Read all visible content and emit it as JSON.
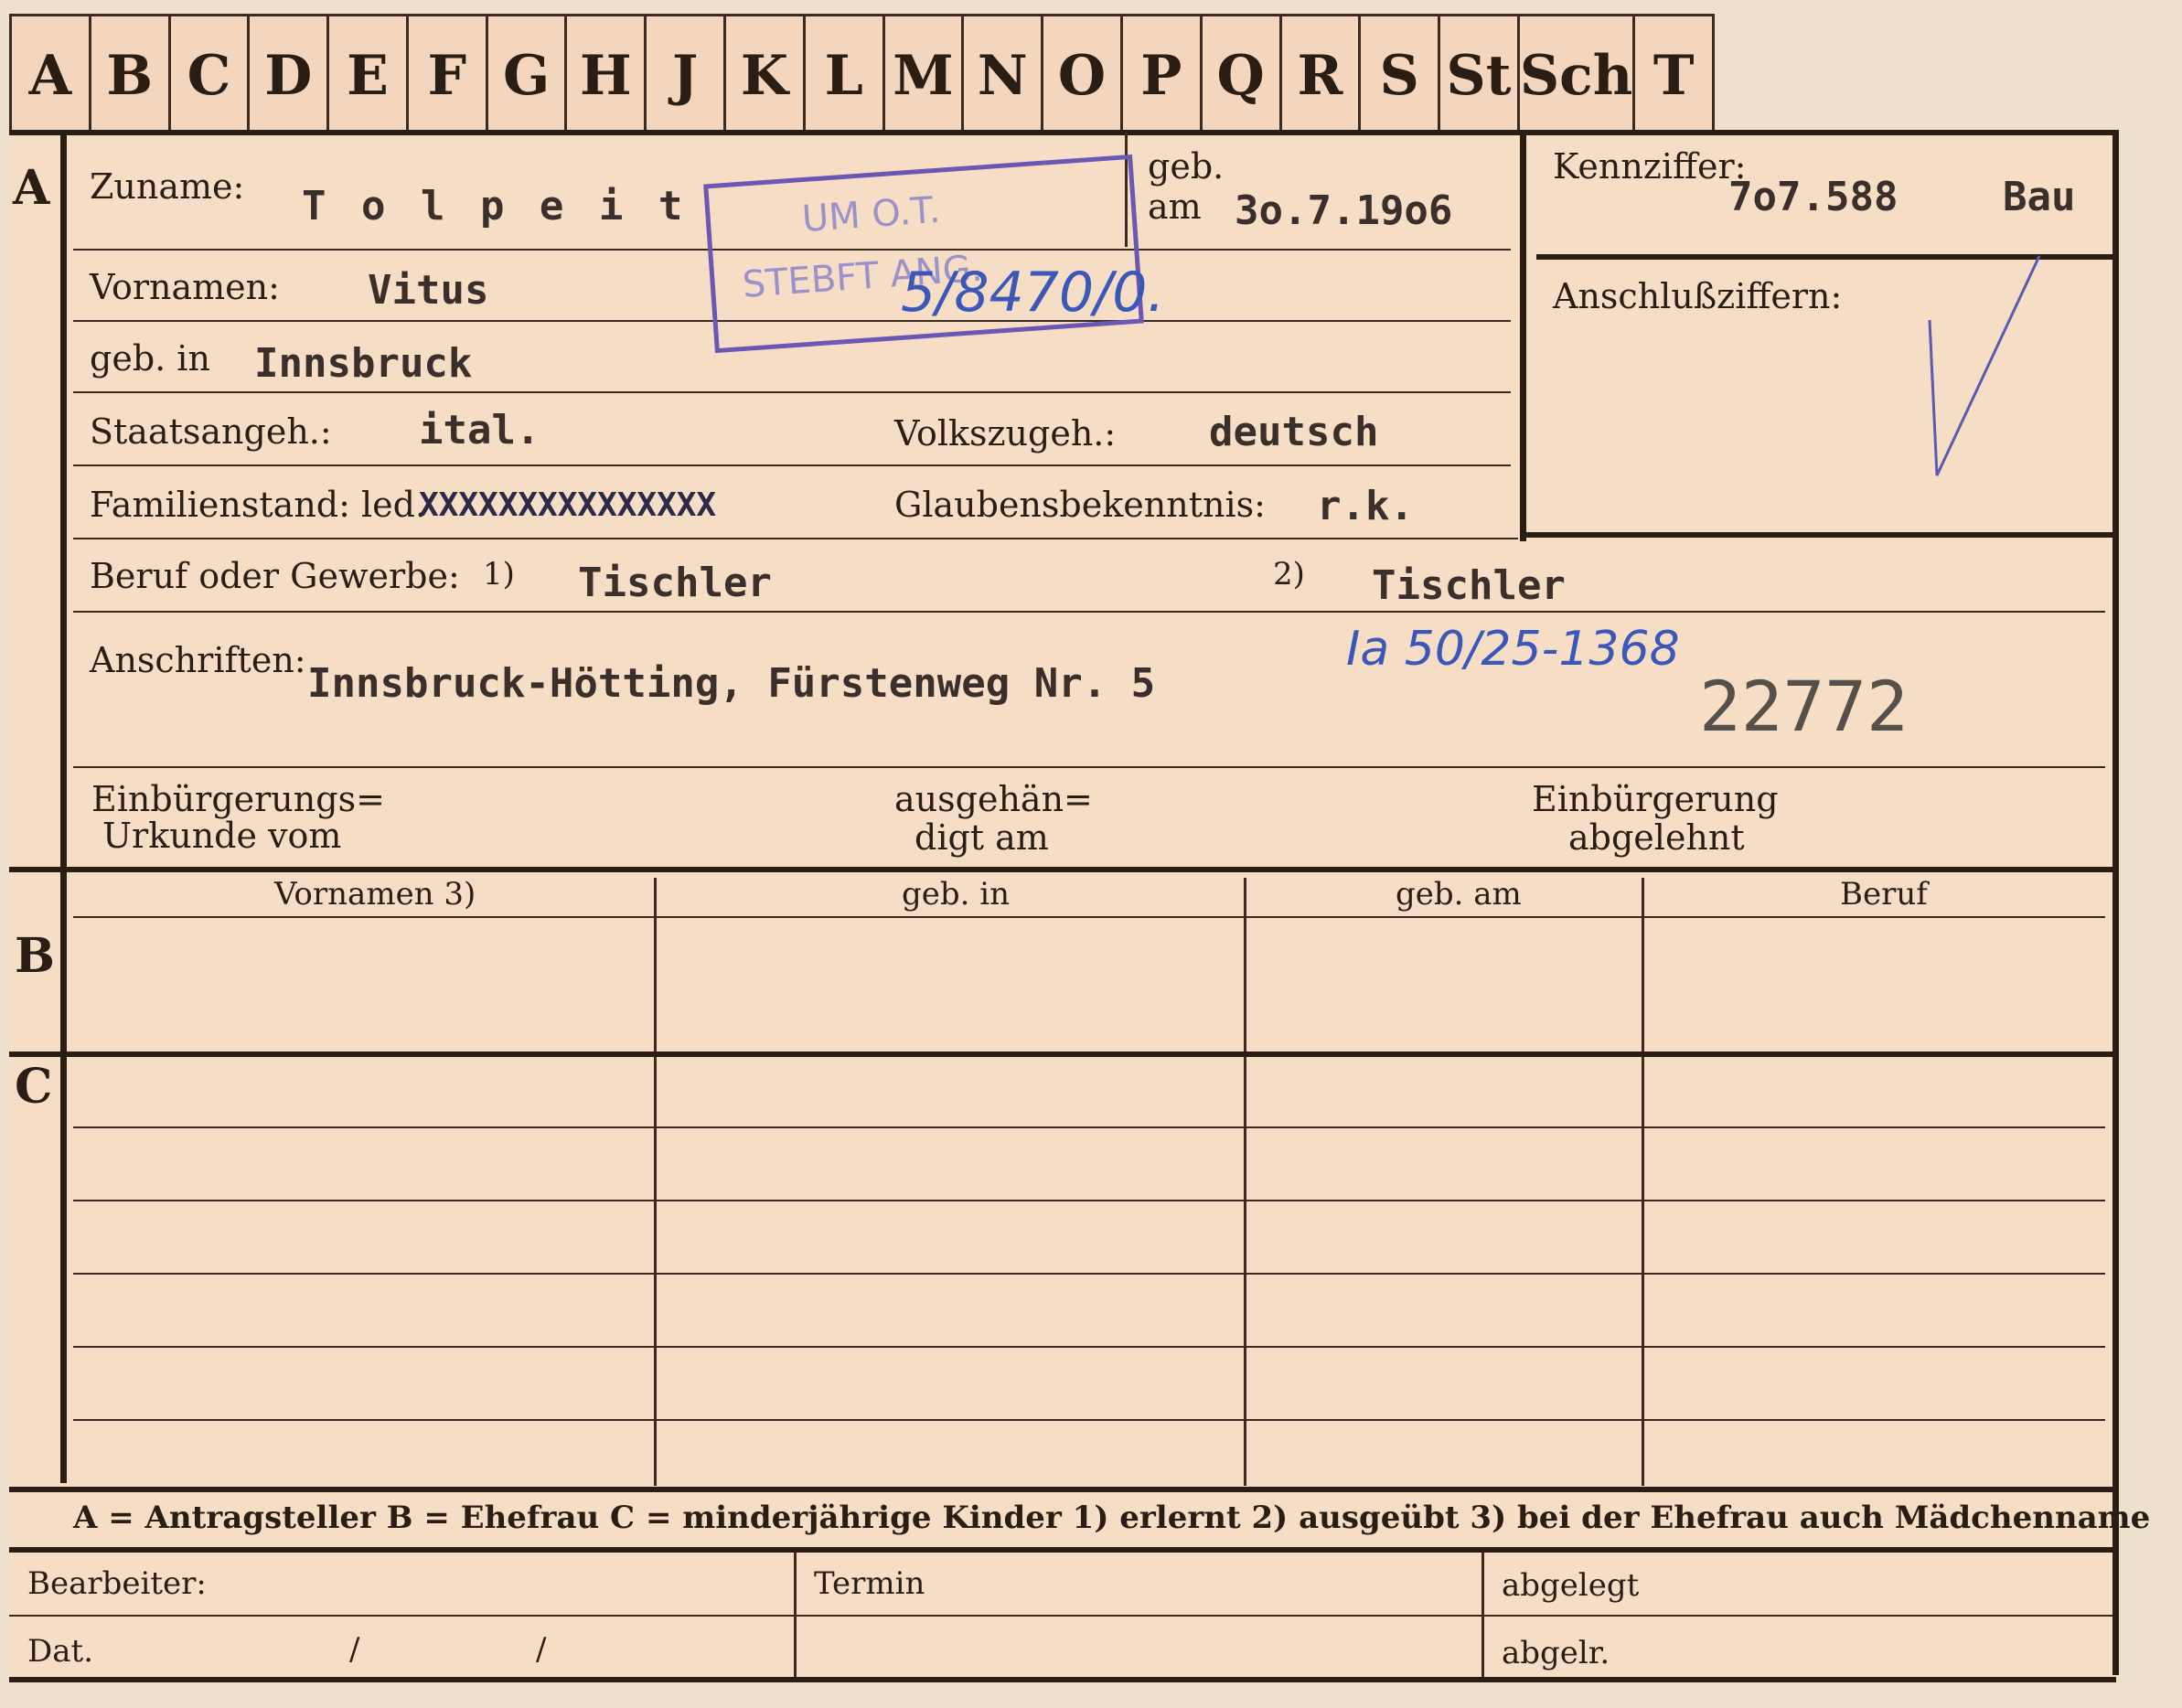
{
  "tabs": [
    "A",
    "B",
    "C",
    "D",
    "E",
    "F",
    "G",
    "H",
    "J",
    "K",
    "L",
    "M",
    "N",
    "O",
    "P",
    "Q",
    "R",
    "S",
    "St",
    "Sch",
    "T"
  ],
  "sections": {
    "a": "A",
    "b": "B",
    "c": "C"
  },
  "labels": {
    "zuname": "Zuname:",
    "geb_am": "geb.\nam",
    "kennziffer": "Kennziffer:",
    "anschlussziffern": "Anschlußziffern:",
    "vornamen": "Vornamen:",
    "geb_in": "geb. in",
    "staatsangeh": "Staatsangeh.:",
    "volkszugeh": "Volkszugeh.:",
    "familienstand": "Familienstand: led.",
    "glaubensbekenntnis": "Glaubensbekenntnis:",
    "beruf": "Beruf oder Gewerbe:",
    "fn1": "1)",
    "fn2": "2)",
    "anschriften": "Anschriften:",
    "einbuergerungs_1": "Einbürgerungs=",
    "einbuergerungs_2": "Urkunde vom",
    "ausgehaen_1": "ausgehän=",
    "ausgehaen_2": "digt am",
    "einbuergerung_1": "Einbürgerung",
    "einbuergerung_2": "abgelehnt"
  },
  "values": {
    "zuname": "T o l p e i t",
    "geb_am": "3o.7.19o6",
    "kennziffer": "7o7.588",
    "kennziffer_suffix": "Bau",
    "vornamen": "Vitus",
    "geb_in": "Innsbruck",
    "staatsangeh": "ital.",
    "volkszugeh": "deutsch",
    "familienstand_struck": "XXXXXXXXXXXXXXX",
    "glaubensbekenntnis": "r.k.",
    "beruf_erlernt": "Tischler",
    "beruf_ausgeuebt": "Tischler",
    "anschrift": "Innsbruck-Hötting, Fürstenweg Nr. 5",
    "number_stamp": "22772"
  },
  "stamp": {
    "line1": "UM O.T.",
    "line2": "STEBFT ANG."
  },
  "handwritten": {
    "stamp_note": "5/8470/0.",
    "file_ref": "Ia 50/25-1368"
  },
  "table_headers": [
    "Vornamen 3)",
    "geb. in",
    "geb. am",
    "Beruf"
  ],
  "legend": "A = Antragsteller   B = Ehefrau   C = minderjährige Kinder   1) erlernt   2) ausgeübt   3) bei der Ehefrau auch Mädchenname",
  "footer": {
    "bearbeiter": "Bearbeiter:",
    "termin": "Termin",
    "abgelegt": "abgelegt",
    "dat": "Dat.",
    "slash1": "/",
    "slash2": "/",
    "abgelr": "abgelr."
  }
}
